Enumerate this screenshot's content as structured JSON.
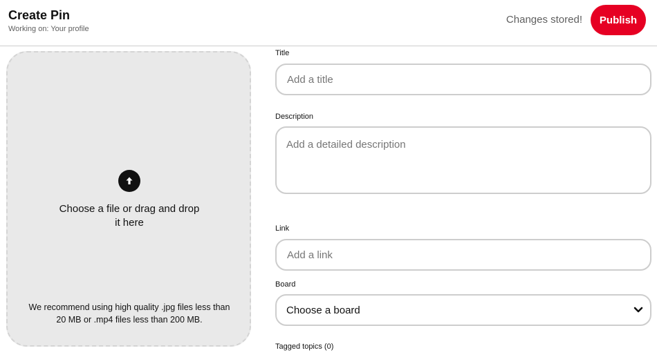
{
  "header": {
    "title": "Create Pin",
    "subtitle": "Working on: Your profile",
    "status": "Changes stored!",
    "publish_label": "Publish"
  },
  "upload": {
    "text": "Choose a file or drag and drop it here",
    "hint": "We recommend using high quality .jpg files less than 20 MB or .mp4 files less than 200 MB."
  },
  "form": {
    "title_label": "Title",
    "title_placeholder": "Add a title",
    "description_label": "Description",
    "description_placeholder": "Add a detailed description",
    "link_label": "Link",
    "link_placeholder": "Add a link",
    "board_label": "Board",
    "board_value": "Choose a board",
    "tagged_topics_label": "Tagged topics (0)"
  },
  "colors": {
    "accent": "#e60023",
    "upload_background": "#e9e9e9"
  },
  "icons": {
    "upload": "upload-arrow-icon",
    "board_dropdown": "chevron-down-icon"
  }
}
